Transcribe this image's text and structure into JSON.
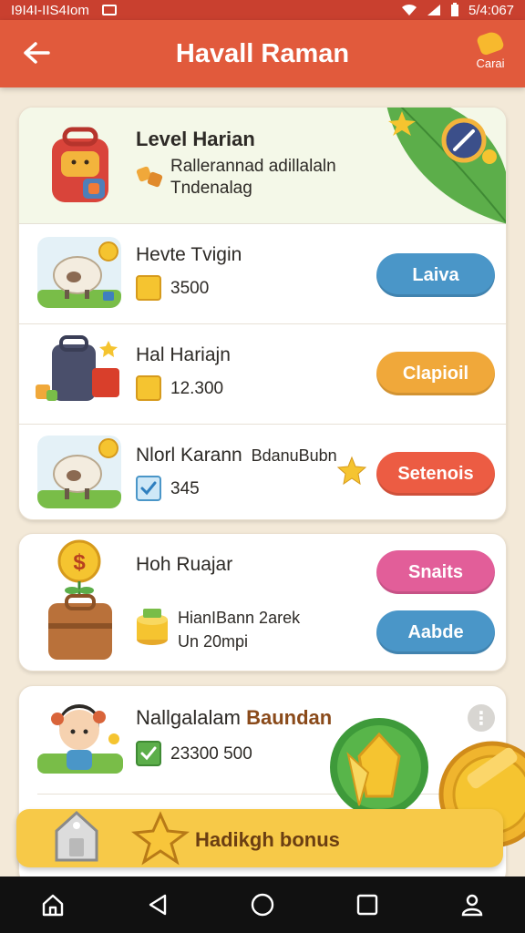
{
  "status_bar": {
    "left_text": "I9I4I-IIS4Iom",
    "right_text": "5/4:067"
  },
  "app_bar": {
    "title": "Havall Raman",
    "cart_label": "Carai"
  },
  "level": {
    "title": "Level Harian",
    "desc_line1": "Rallerannad adillalaln",
    "desc_line2": "Tndenalag"
  },
  "tasks": [
    {
      "title": "Hevte Tvigin",
      "value": "3500",
      "button": "Laiva",
      "button_color": "#4a96c8"
    },
    {
      "title": "Hal Hariajn",
      "value": "12.300",
      "button": "Clapioil",
      "button_color": "#f0a83a"
    },
    {
      "title": "Nlorl Karann",
      "subtitle": "BdanuBubn",
      "value": "345",
      "button": "Setenois",
      "button_color": "#ec5c43"
    }
  ],
  "wallet": {
    "title": "Hoh Ruajar",
    "line1": "HianIBann 2arek",
    "line2": "Un 20mpi",
    "button1": "Snaits",
    "button1_color": "#e25e99",
    "button2": "Aabde",
    "button2_color": "#4a96c8"
  },
  "reward": {
    "title_part1": "Nallgalalam",
    "title_part2": "Baundan",
    "value": "23300 500"
  },
  "bonus": {
    "label": "Hadikgh bonus"
  },
  "nav": {
    "items": [
      "home-icon",
      "back-icon",
      "circle-home-icon",
      "recent-apps-icon",
      "profile-icon"
    ]
  },
  "colors": {
    "app_bar": "#e15a3c",
    "status_bar": "#c9402f",
    "bonus": "#f7c948"
  }
}
